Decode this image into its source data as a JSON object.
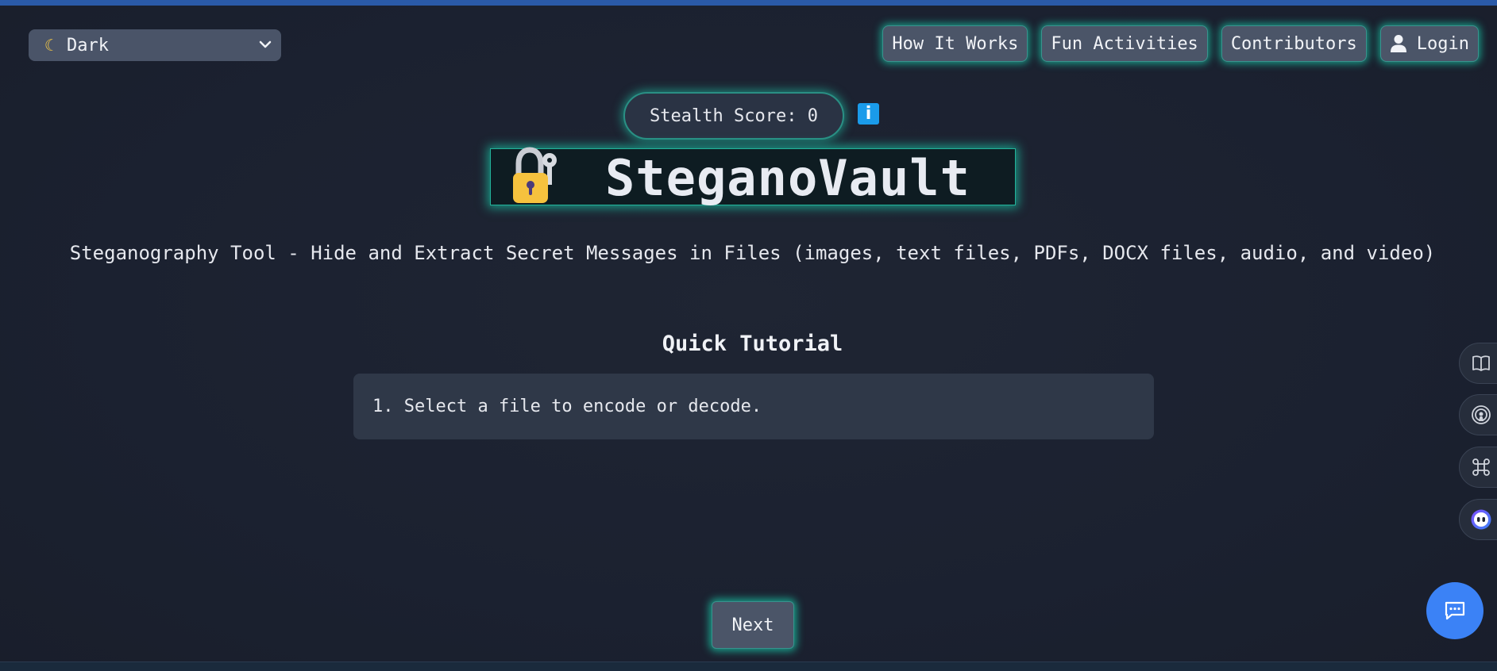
{
  "theme_select": {
    "icon": "moon-icon",
    "selected": "Dark"
  },
  "nav": {
    "items": [
      {
        "label": "How It Works"
      },
      {
        "label": "Fun Activities"
      },
      {
        "label": "Contributors"
      },
      {
        "label": "Login",
        "icon": "user-icon"
      }
    ]
  },
  "stealth": {
    "label": "Stealth Score: 0",
    "info_label": "i"
  },
  "brand": {
    "title": "SteganoVault",
    "icon": "lock-with-key-icon"
  },
  "subtitle": "Steganography Tool - Hide and Extract Secret Messages in Files (images, text files, PDFs, DOCX files, audio, and video)",
  "tutorial": {
    "heading": "Quick Tutorial",
    "step_text": "1. Select a file to encode or decode.",
    "next_label": "Next"
  },
  "side_tools": [
    "book-icon",
    "broadcast-icon",
    "command-icon",
    "assistant-bot-icon"
  ],
  "chat": {
    "icon": "chat-bubble-icon"
  },
  "colors": {
    "background": "#1c2230",
    "accent_glow": "#1ac9a8",
    "button_bg": "#4b5568",
    "info_blue": "#1a9bea",
    "chat_blue": "#3b82f6"
  }
}
